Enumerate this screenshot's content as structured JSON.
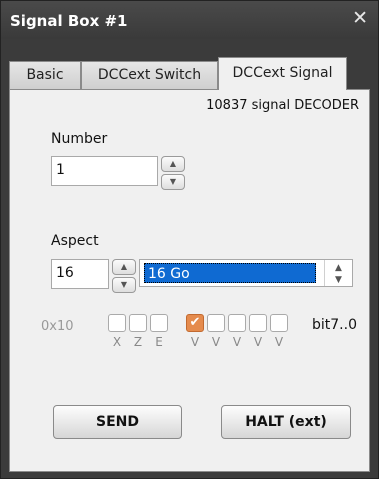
{
  "window": {
    "title": "Signal Box #1",
    "close_glyph": "✕"
  },
  "tabs": [
    {
      "label": "Basic",
      "active": false
    },
    {
      "label": "DCCext Switch",
      "active": false
    },
    {
      "label": "DCCext Signal",
      "active": true
    }
  ],
  "decoder_label": "10837 signal DECODER",
  "number": {
    "label": "Number",
    "value": "1"
  },
  "aspect": {
    "label": "Aspect",
    "value": "16",
    "selected_option": "16 Go"
  },
  "bits": {
    "hex": "0x10",
    "boxes": [
      false,
      false,
      false,
      true,
      false,
      false,
      false,
      false
    ],
    "labels": [
      "X",
      "Z",
      "E",
      "V",
      "V",
      "V",
      "V",
      "V"
    ],
    "range_label": "bit7..0"
  },
  "buttons": {
    "send": "SEND",
    "halt": "HALT (ext)"
  }
}
